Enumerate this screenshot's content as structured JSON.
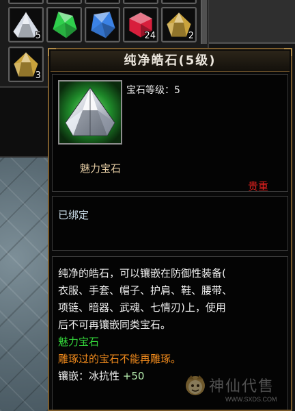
{
  "inventory": {
    "slots": [
      {
        "gem": "white-gem",
        "color": "#d6dce6",
        "count": "5"
      },
      {
        "gem": "green-gem",
        "color": "#2fcf4c",
        "count": ""
      },
      {
        "gem": "blue-gem",
        "color": "#3b82e6",
        "count": ""
      },
      {
        "gem": "red-gem",
        "color": "#d81f3c",
        "count": "24"
      },
      {
        "gem": "gold-gem",
        "color": "#c9a33c",
        "count": "2"
      },
      {
        "gem": "gold-gem",
        "color": "#c9a33c",
        "count": "3"
      }
    ]
  },
  "tooltip": {
    "title": "纯净皓石(5级)",
    "level_label": "宝石等级：5",
    "gem_type": "魅力宝石",
    "rarity": "贵重",
    "bound": "已绑定",
    "description_lines": [
      "纯净的皓石，可以镶嵌在防御性装备(",
      "衣服、手套、帽子、护肩、鞋、腰带、",
      "项链、暗器、武魂、七情刃)上，使用",
      "后不可再镶嵌同类宝石。"
    ],
    "effect_type": "魅力宝石",
    "carve_note": "雕琢过的宝石不能再雕琢。",
    "inlay_label": "镶嵌：冰抗性",
    "inlay_value": "+50"
  },
  "colors": {
    "gem_type": "#e2caa2",
    "rarity": "#e0201e",
    "bound": "#cfe3f0",
    "effect_type": "#33d63a",
    "carve_note": "#f08a1c",
    "inlay_value": "#b8f0b0",
    "border": "#7c5c2c"
  },
  "watermark": {
    "brand": "神仙代售",
    "url": "WWW.SXDS.COM"
  }
}
